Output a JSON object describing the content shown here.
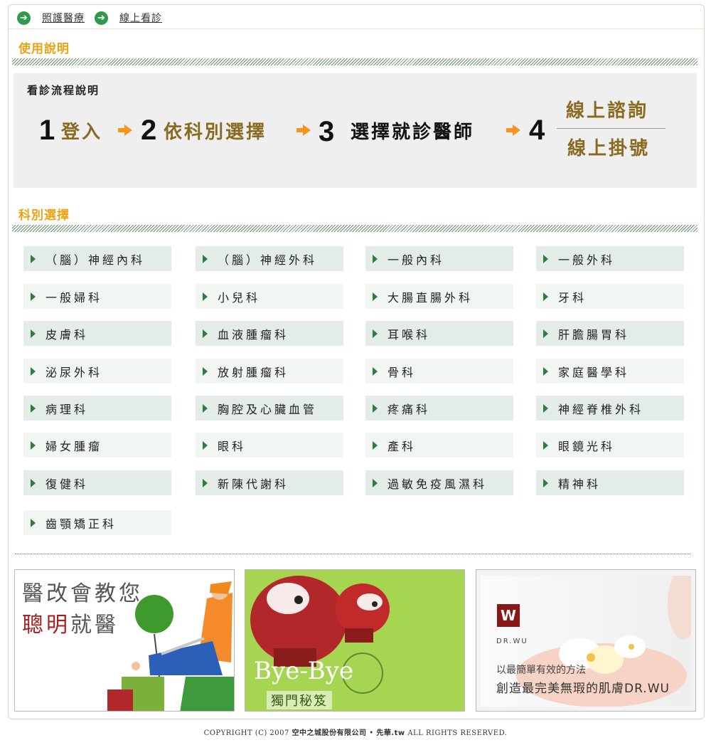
{
  "nav": {
    "items": [
      {
        "label": "照護醫療"
      },
      {
        "label": "線上看診"
      }
    ]
  },
  "usage": {
    "title": "使用說明",
    "process_title": "看診流程說明",
    "steps": [
      {
        "num": "1",
        "text": "登入"
      },
      {
        "num": "2",
        "text": "依科別選擇"
      },
      {
        "num": "3",
        "text": "選擇就診醫師"
      },
      {
        "num": "4",
        "text_top": "線上諮詢",
        "text_bottom": "線上掛號"
      }
    ]
  },
  "departments": {
    "title": "科別選擇",
    "items": [
      "（腦）神經內科",
      "（腦）神經外科",
      "一般內科",
      "一般外科",
      "一般婦科",
      "小兒科",
      "大腸直腸外科",
      "牙科",
      "皮膚科",
      "血液腫瘤科",
      "耳喉科",
      "肝膽腸胃科",
      "泌尿外科",
      "放射腫瘤科",
      "骨科",
      "家庭醫學科",
      "病理科",
      "胸腔及心臟血管",
      "疼痛科",
      "神經脊椎外科",
      "婦女腫瘤",
      "眼科",
      "產科",
      "眼鏡光科",
      "復健科",
      "新陳代謝科",
      "過敏免疫風濕科",
      "精神科",
      "齒顎矯正科"
    ]
  },
  "banners": {
    "b1": {
      "line1": "醫改會教您",
      "line2_red": "聰明",
      "line2_rest": "就醫"
    },
    "b2": {
      "title": "Bye-Bye",
      "subtitle": "獨門秘笈"
    },
    "b3": {
      "brand": "DR.WU",
      "line1": "以最簡單有效的方法",
      "line2": "創造最完美無瑕的肌膚DR.WU"
    }
  },
  "footer": {
    "prefix": "COPYRIGHT (C) 2007 ",
    "company": "空中之城股份有限公司",
    "dot": " • ",
    "site": "先華.tw",
    "suffix": " ALL RIGHTS RESERVED."
  },
  "colors": {
    "accent": "#e8a317",
    "nav_icon": "#2f9a4b",
    "arrow": "#f7941d",
    "step_brown": "#8a6a20"
  }
}
